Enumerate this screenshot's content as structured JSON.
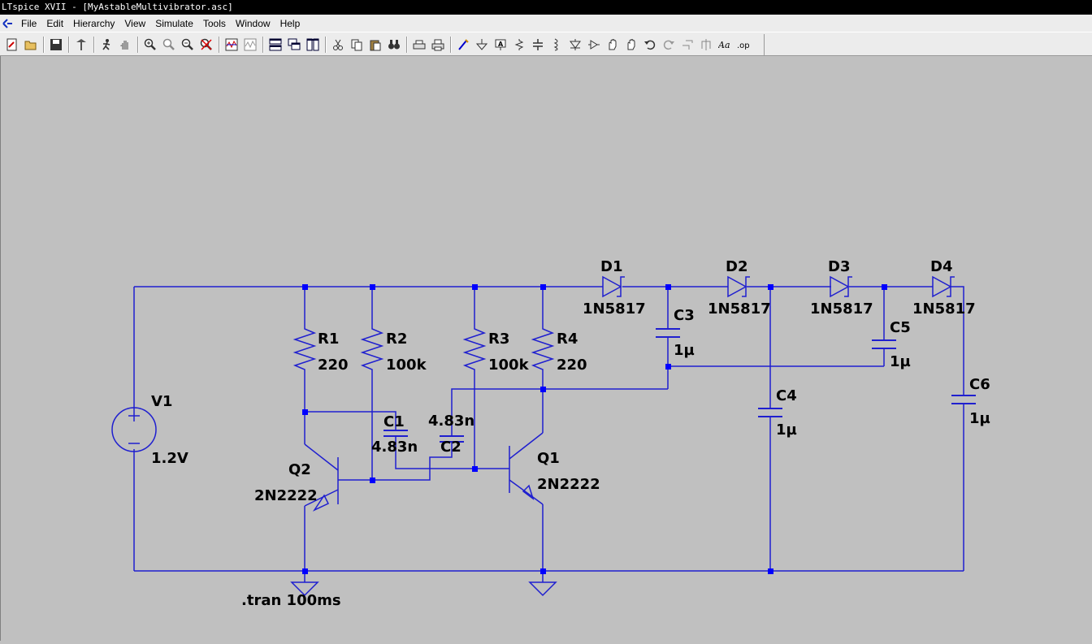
{
  "window": {
    "title": "LTspice XVII - [MyAstableMultivibrator.asc]"
  },
  "menu": {
    "items": [
      {
        "key": "file",
        "label": "File"
      },
      {
        "key": "edit",
        "label": "Edit"
      },
      {
        "key": "hierarchy",
        "label": "Hierarchy"
      },
      {
        "key": "view",
        "label": "View"
      },
      {
        "key": "simulate",
        "label": "Simulate"
      },
      {
        "key": "tools",
        "label": "Tools"
      },
      {
        "key": "window",
        "label": "Window"
      },
      {
        "key": "help",
        "label": "Help"
      }
    ]
  },
  "toolbar": {
    "icons": [
      "new-schematic-icon",
      "open-icon",
      "save-icon",
      "control-panel-icon",
      "run-icon",
      "halt-icon",
      "zoom-in-icon",
      "pan-icon",
      "zoom-out-icon",
      "zoom-fit-icon",
      "waveform-icon",
      "autorange-icon",
      "tile-horizontal-icon",
      "cascade-icon",
      "tile-vertical-icon",
      "cut-icon",
      "copy-icon",
      "paste-icon",
      "find-icon",
      "print-setup-icon",
      "print-icon",
      "wire-icon",
      "ground-icon",
      "label-net-icon",
      "resistor-icon",
      "capacitor-icon",
      "inductor-icon",
      "diode-icon",
      "component-icon",
      "move-icon",
      "drag-icon",
      "undo-icon",
      "redo-icon",
      "rotate-icon",
      "mirror-icon",
      "text-icon",
      "spice-directive-icon"
    ]
  },
  "schematic": {
    "components": {
      "d1": {
        "ref": "D1",
        "value": "1N5817"
      },
      "d2": {
        "ref": "D2",
        "value": "1N5817"
      },
      "d3": {
        "ref": "D3",
        "value": "1N5817"
      },
      "d4": {
        "ref": "D4",
        "value": "1N5817"
      },
      "r1": {
        "ref": "R1",
        "value": "220"
      },
      "r2": {
        "ref": "R2",
        "value": "100k"
      },
      "r3": {
        "ref": "R3",
        "value": "100k"
      },
      "r4": {
        "ref": "R4",
        "value": "220"
      },
      "c1": {
        "ref": "C1",
        "value": "4.83n"
      },
      "c2": {
        "ref": "C2",
        "value": "4.83n"
      },
      "c3": {
        "ref": "C3",
        "value": "1µ"
      },
      "c4": {
        "ref": "C4",
        "value": "1µ"
      },
      "c5": {
        "ref": "C5",
        "value": "1µ"
      },
      "c6": {
        "ref": "C6",
        "value": "1µ"
      },
      "v1": {
        "ref": "V1",
        "value": "1.2V"
      },
      "q1": {
        "ref": "Q1",
        "value": "2N2222"
      },
      "q2": {
        "ref": "Q2",
        "value": "2N2222"
      }
    },
    "directive": ".tran 100ms",
    "wire_color": "#1f1fcf",
    "junction_color": "#0000ff"
  }
}
